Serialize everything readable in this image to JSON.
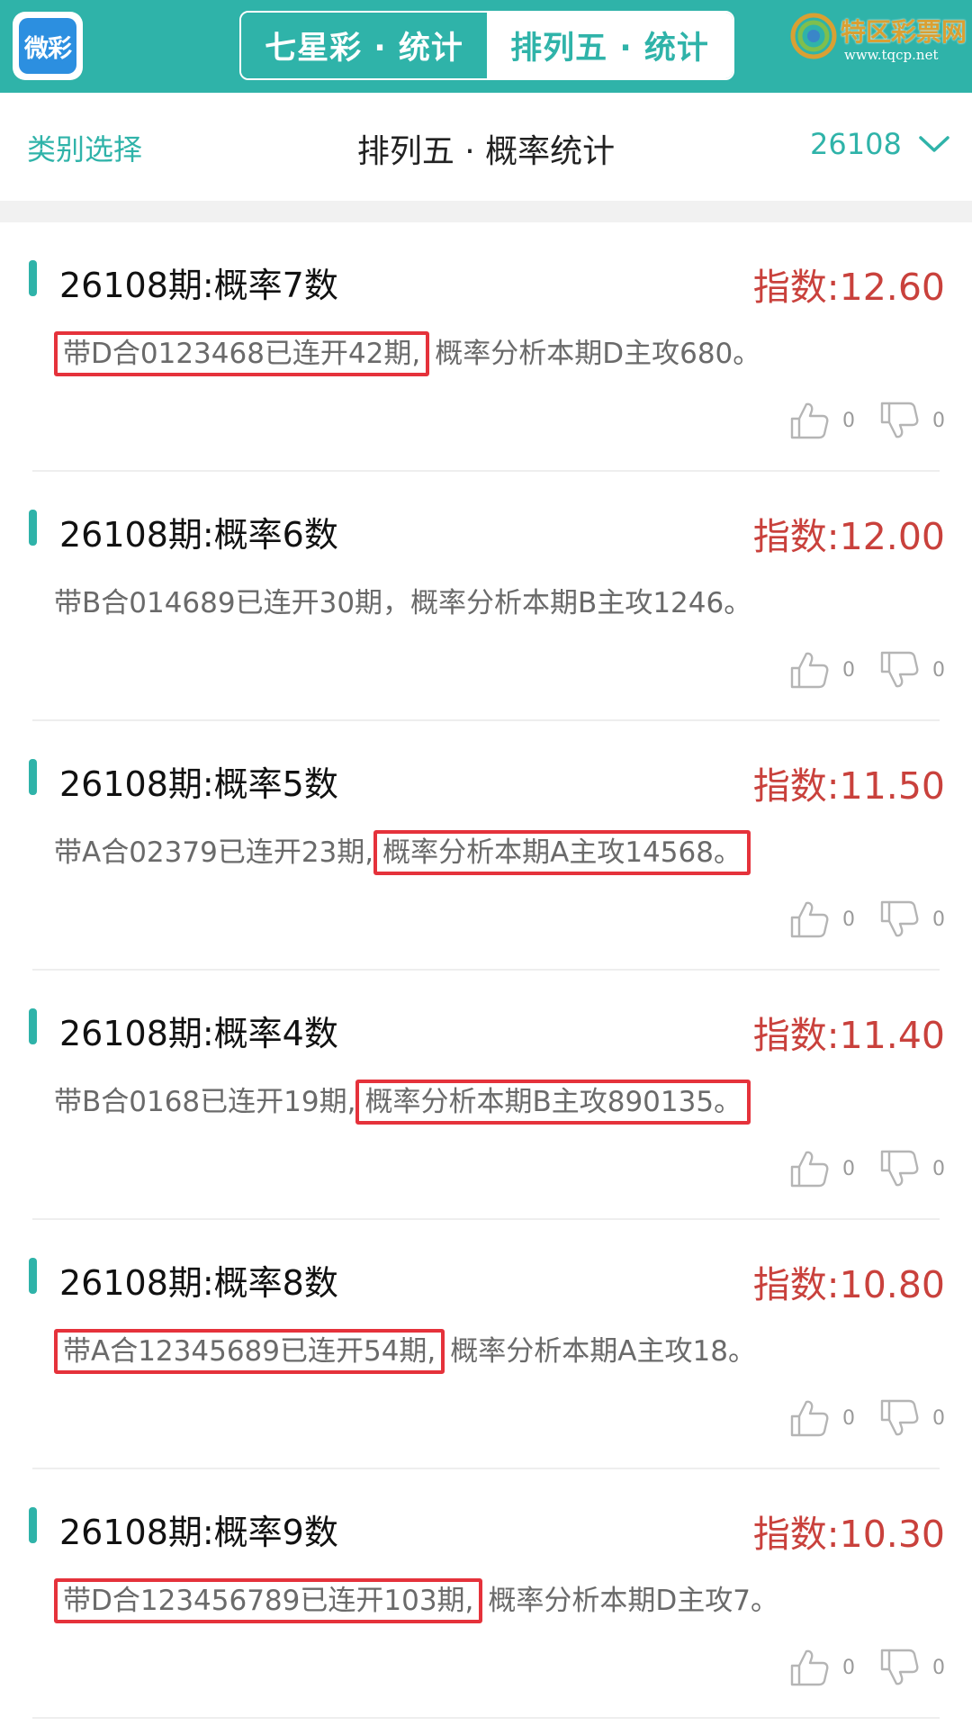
{
  "app": {
    "logo_text": "微彩",
    "tabs": [
      {
        "label": "七星彩 · 统计",
        "active": false
      },
      {
        "label": "排列五 · 统计",
        "active": true
      }
    ]
  },
  "watermark": {
    "title": "特区彩票网",
    "url": "www.tqcp.net"
  },
  "subheader": {
    "category_label": "类别选择",
    "title": "排列五 · 概率统计",
    "period": "26108",
    "period_icon": "chevron-down-icon"
  },
  "colors": {
    "accent": "#2fb3a9",
    "index_red": "#c9413c",
    "highlight_red": "#e5323b"
  },
  "cards": [
    {
      "title": "26108期:概率7数",
      "index": "指数:12.60",
      "desc_pre": "",
      "desc_hl": "带D合0123468已连开42期,",
      "desc_post": "概率分析本期D主攻680。",
      "likes": "0",
      "dislikes": "0"
    },
    {
      "title": "26108期:概率6数",
      "index": "指数:12.00",
      "desc_pre": "带B合014689已连开30期，概率分析本期B主攻1246。",
      "desc_hl": "",
      "desc_post": "",
      "likes": "0",
      "dislikes": "0"
    },
    {
      "title": "26108期:概率5数",
      "index": "指数:11.50",
      "desc_pre": "带A合02379已连开23期,",
      "desc_hl": "概率分析本期A主攻14568。",
      "desc_post": "",
      "likes": "0",
      "dislikes": "0"
    },
    {
      "title": "26108期:概率4数",
      "index": "指数:11.40",
      "desc_pre": "带B合0168已连开19期,",
      "desc_hl": "概率分析本期B主攻890135。",
      "desc_post": "",
      "likes": "0",
      "dislikes": "0"
    },
    {
      "title": "26108期:概率8数",
      "index": "指数:10.80",
      "desc_pre": "",
      "desc_hl": "带A合12345689已连开54期,",
      "desc_post": "概率分析本期A主攻18。",
      "likes": "0",
      "dislikes": "0"
    },
    {
      "title": "26108期:概率9数",
      "index": "指数:10.30",
      "desc_pre": "",
      "desc_hl": "带D合123456789已连开103期,",
      "desc_post": "概率分析本期D主攻7。",
      "likes": "0",
      "dislikes": "0"
    }
  ]
}
